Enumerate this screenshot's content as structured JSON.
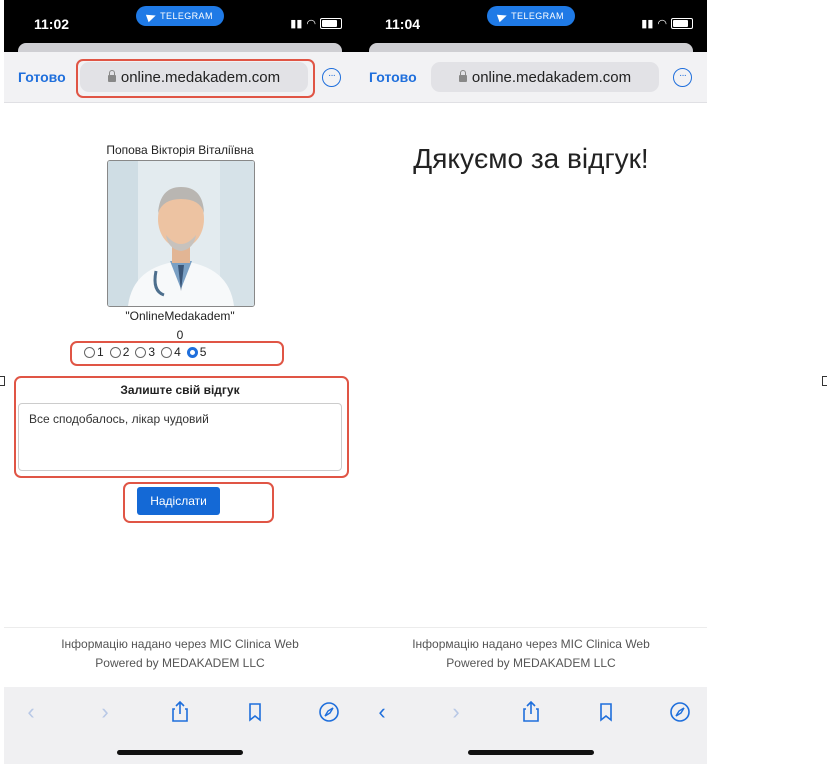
{
  "left": {
    "status": {
      "time": "11:02",
      "telegram_label": "TELEGRAM"
    },
    "browser": {
      "done_label": "Готово",
      "url": "online.medakadem.com"
    },
    "doctor": {
      "name": "Попова Вікторія Віталіївна",
      "org": "\"OnlineMedakadem\"",
      "count": "0"
    },
    "rating": {
      "options": [
        "1",
        "2",
        "3",
        "4",
        "5"
      ],
      "selected": "5"
    },
    "feedback": {
      "title": "Залиште свій відгук",
      "text": "Все сподобалось, лікар чудовий"
    },
    "send_label": "Надіслати",
    "footer": {
      "line1": "Інформацію надано через MIC Clinica Web",
      "line2": "Powered by MEDAKADEM LLC"
    }
  },
  "right": {
    "status": {
      "time": "11:04",
      "telegram_label": "TELEGRAM"
    },
    "browser": {
      "done_label": "Готово",
      "url": "online.medakadem.com"
    },
    "thanks": "Дякуємо за відгук!",
    "footer": {
      "line1": "Інформацію надано через MIC Clinica Web",
      "line2": "Powered by MEDAKADEM LLC"
    }
  },
  "icons": [
    "back-icon",
    "forward-icon",
    "share-icon",
    "bookmarks-icon",
    "compass-icon",
    "more-icon",
    "lock-icon",
    "telegram-icon"
  ],
  "colors": {
    "accent": "#1f6fdc",
    "highlight": "#e05545",
    "button": "#1469d6"
  }
}
